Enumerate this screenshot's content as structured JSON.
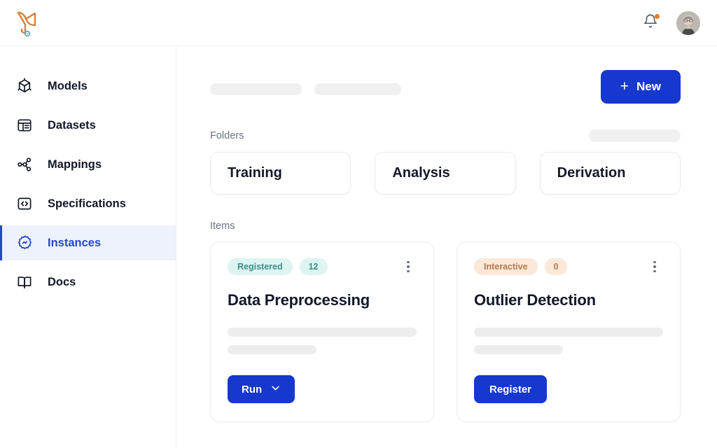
{
  "brand": {
    "logo_icon": "vexel-logo-icon"
  },
  "topbar": {
    "notifications_icon": "bell-icon",
    "has_unread": true,
    "avatar_icon": "user-avatar"
  },
  "sidebar": {
    "items": [
      {
        "label": "Models",
        "icon": "cube-icon",
        "active": false
      },
      {
        "label": "Datasets",
        "icon": "table-icon",
        "active": false
      },
      {
        "label": "Mappings",
        "icon": "network-icon",
        "active": false
      },
      {
        "label": "Specifications",
        "icon": "code-icon",
        "active": false
      },
      {
        "label": "Instances",
        "icon": "gear-badge-icon",
        "active": true
      },
      {
        "label": "Docs",
        "icon": "book-icon",
        "active": false
      }
    ]
  },
  "main": {
    "new_button": {
      "label": "New",
      "icon": "plus-icon"
    },
    "folders_label": "Folders",
    "items_label": "Items",
    "folders": [
      {
        "name": "Training"
      },
      {
        "name": "Analysis"
      },
      {
        "name": "Derivation"
      }
    ],
    "items": [
      {
        "status": "Registered",
        "count": "12",
        "status_style": "teal",
        "title": "Data Preprocessing",
        "action_label": "Run",
        "action_icon": "chevron-down-icon",
        "menu_icon": "more-vertical-icon"
      },
      {
        "status": "Interactive",
        "count": "0",
        "status_style": "peach",
        "title": "Outlier Detection",
        "action_label": "Register",
        "action_icon": "",
        "menu_icon": "more-vertical-icon"
      }
    ]
  },
  "colors": {
    "accent_blue": "#1638ce",
    "active_nav_bg": "#eef2fd",
    "active_nav_text": "#2348c8",
    "badge_teal_bg": "#ddf4f1",
    "badge_teal_text": "#3a8e88",
    "badge_peach_bg": "#fbe8d9",
    "badge_peach_text": "#b6794a",
    "notification_dot": "#f07c20",
    "logo_orange": "#d4803f",
    "skeleton_gray": "#f0f0f1"
  }
}
